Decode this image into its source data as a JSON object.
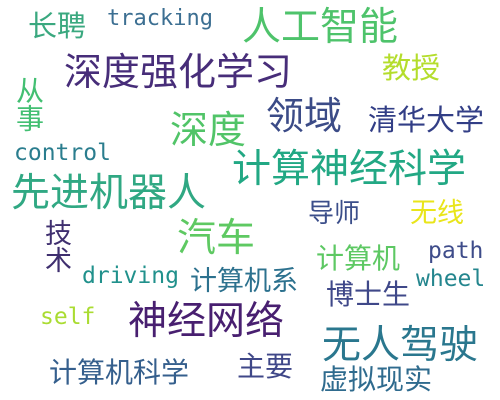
{
  "words": {
    "changpin": {
      "text": "长聘",
      "color": "#3aa87f"
    },
    "tracking": {
      "text": "tracking",
      "color": "#3c6f92"
    },
    "rengong_zhineng": {
      "text": "人工智能",
      "color": "#4ec36b"
    },
    "shendu_qianghua": {
      "text": "深度强化学习",
      "color": "#472d79"
    },
    "jiaoshou": {
      "text": "教授",
      "color": "#b4dd2c"
    },
    "congshi": {
      "text": "从事",
      "color": "#43bf72"
    },
    "shendu": {
      "text": "深度",
      "color": "#51c468"
    },
    "lingyu": {
      "text": "领域",
      "color": "#3b4b87"
    },
    "qinghua": {
      "text": "清华大学",
      "color": "#323e86"
    },
    "control": {
      "text": "control",
      "color": "#2a7d8e"
    },
    "jisuan_shenjing": {
      "text": "计算神经科学",
      "color": "#22a884"
    },
    "xianjin_jiqiren": {
      "text": "先进机器人",
      "color": "#30a883"
    },
    "daoshi": {
      "text": "导师",
      "color": "#3b4e8a"
    },
    "wuxian": {
      "text": "无线",
      "color": "#e9e51a"
    },
    "qiche": {
      "text": "汽车",
      "color": "#5ec962"
    },
    "jishu": {
      "text": "技术",
      "color": "#3f2f6f"
    },
    "jisuanji": {
      "text": "计算机",
      "color": "#5dc863"
    },
    "path": {
      "text": "path",
      "color": "#3e4c8a"
    },
    "driving": {
      "text": "driving",
      "color": "#21918c"
    },
    "jisuanji_xi": {
      "text": "计算机系",
      "color": "#2c718e"
    },
    "wheel": {
      "text": "wheel",
      "color": "#24868e"
    },
    "boshisheng": {
      "text": "博士生",
      "color": "#3f4889"
    },
    "self": {
      "text": "self",
      "color": "#aadc32"
    },
    "shenjing_wangluo": {
      "text": "神经网络",
      "color": "#481f70"
    },
    "wuren_jiashi": {
      "text": "无人驾驶",
      "color": "#2a778e"
    },
    "jisuanji_kexue": {
      "text": "计算机科学",
      "color": "#355f8d"
    },
    "zhuyao": {
      "text": "主要",
      "color": "#3f4788"
    },
    "xuni_xianshi": {
      "text": "虚拟现实",
      "color": "#2f6b8e"
    }
  }
}
